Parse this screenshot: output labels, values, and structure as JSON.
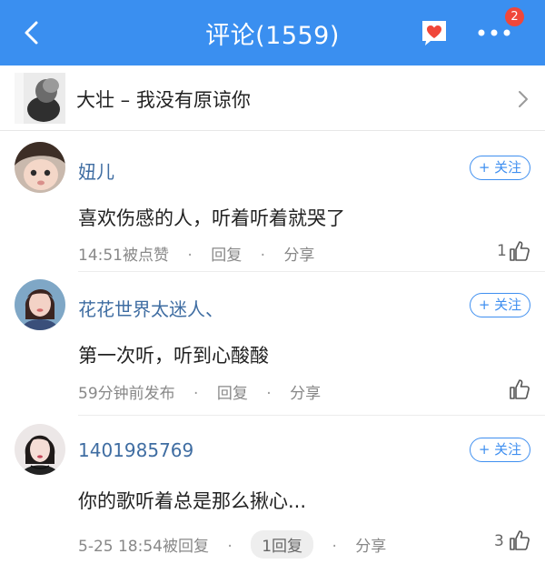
{
  "header": {
    "title": "评论(1559)",
    "badge_count": "2",
    "colors": {
      "bar": "#3a8ff0",
      "badge": "#f0473a",
      "heart": "#f0473a"
    },
    "icons": [
      "back-arrow-icon",
      "heart-icon",
      "more-dots-icon"
    ]
  },
  "song": {
    "title": "大壮 – 我没有原谅你",
    "icon": "chevron-right-icon"
  },
  "comments": [
    {
      "username": "妞儿",
      "follow_label": "+ 关注",
      "text": "喜欢伤感的人，听着听着就哭了",
      "time": "14:51被点赞",
      "reply_label": "回复",
      "share_label": "分享",
      "likes": "1"
    },
    {
      "username": "花花世界太迷人、",
      "follow_label": "+ 关注",
      "text": "第一次听，听到心酸酸",
      "time": "59分钟前发布",
      "reply_label": "回复",
      "share_label": "分享",
      "likes": ""
    },
    {
      "username": "1401985769",
      "follow_label": "+ 关注",
      "text": "你的歌听着总是那么揪心...",
      "time": "5-25 18:54被回复",
      "reply_label": "1回复",
      "share_label": "分享",
      "likes": "3"
    }
  ]
}
